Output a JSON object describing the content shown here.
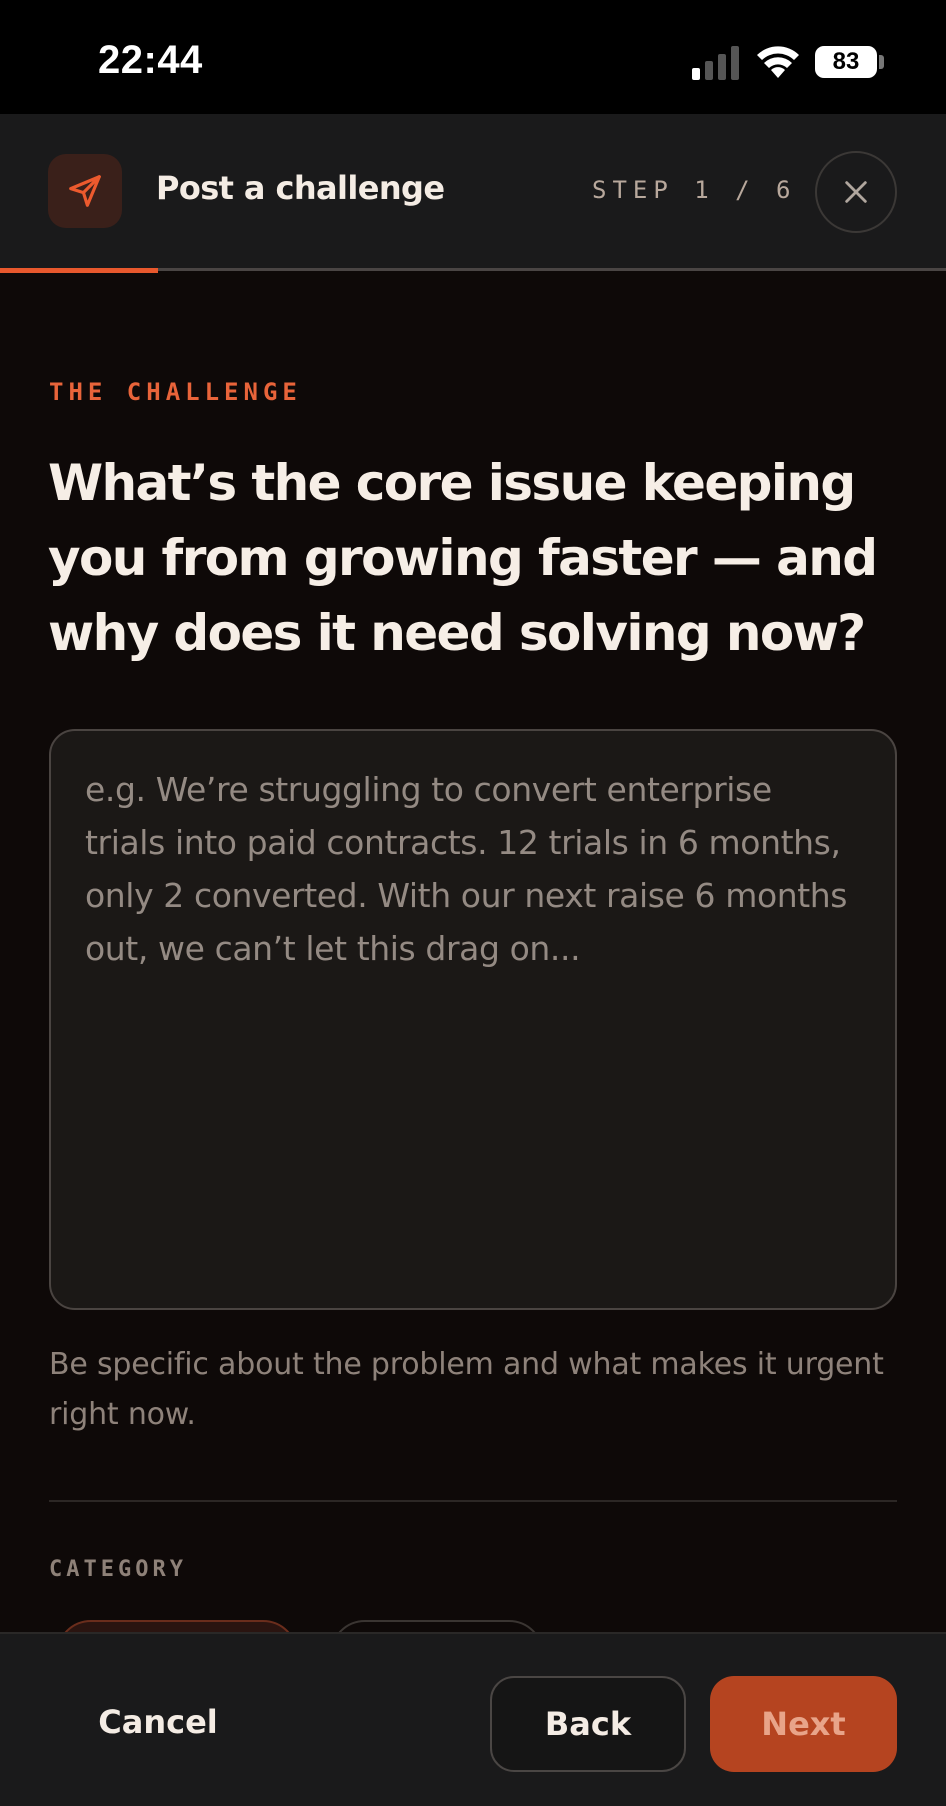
{
  "status_bar": {
    "time": "22:44",
    "battery": "83",
    "icons": [
      "signal-icon",
      "wifi-icon",
      "battery-icon"
    ]
  },
  "header": {
    "icon": "send-icon",
    "title": "Post a challenge",
    "step": "STEP 1 / 6",
    "progress": 0.1667,
    "close_icon": "close-icon"
  },
  "content": {
    "eyebrow": "THE CHALLENGE",
    "question": "What’s the core issue keeping you from growing faster — and why does it need solving now?",
    "textarea": {
      "value": "",
      "placeholder": "e.g. We’re struggling to convert enterprise trials into paid contracts. 12 trials in 6 months, only 2 converted. With our next raise 6 months out, we can’t let this drag on..."
    },
    "helper": "Be specific about the problem and what makes it urgent right now.",
    "category_label": "CATEGORY"
  },
  "footer": {
    "cancel": "Cancel",
    "back": "Back",
    "next": "Next"
  },
  "colors": {
    "accent": "#e8582d",
    "button_primary": "#b54420",
    "background": "#0e0908",
    "surface": "#1a1a1b"
  }
}
